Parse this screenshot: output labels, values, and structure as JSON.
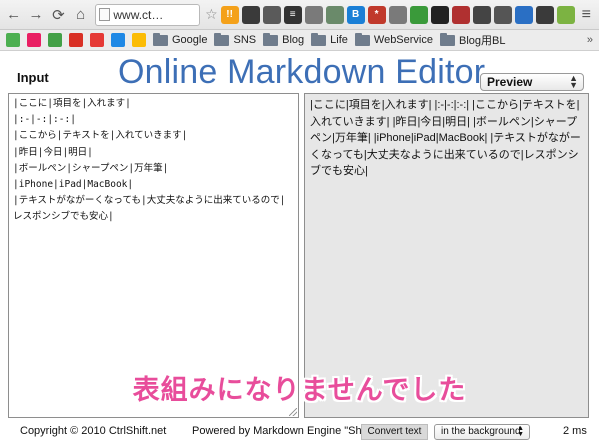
{
  "browser": {
    "url": "www.ct…",
    "extensions": [
      {
        "icon": "ext-hatebu-icon",
        "text": "!!",
        "color": "#f4a11a"
      },
      {
        "icon": "ext-evernote-icon",
        "text": "",
        "color": "#3a3a3a"
      },
      {
        "icon": "ext-gear-icon",
        "text": "",
        "color": "#5a5a5a"
      },
      {
        "icon": "ext-stack-icon",
        "text": "≡",
        "color": "#333333"
      },
      {
        "icon": "ext-pocket-icon",
        "text": "",
        "color": "#7a7a7a"
      },
      {
        "icon": "ext-elephant-icon",
        "text": "",
        "color": "#6a8a6a"
      },
      {
        "icon": "ext-b-icon",
        "text": "B",
        "color": "#1a7fd6"
      },
      {
        "icon": "ext-asterisk-icon",
        "text": "*",
        "color": "#c0392b"
      },
      {
        "icon": "ext-copy-icon",
        "text": "",
        "color": "#7a7a7a"
      },
      {
        "icon": "ext-leaf-icon",
        "text": "",
        "color": "#3a9a3a"
      },
      {
        "icon": "ext-circle-icon",
        "text": "",
        "color": "#222222"
      },
      {
        "icon": "ext-mask-icon",
        "text": "",
        "color": "#b03030"
      },
      {
        "icon": "ext-camera-icon",
        "text": "",
        "color": "#444444"
      },
      {
        "icon": "ext-pin-icon",
        "text": "",
        "color": "#555555"
      },
      {
        "icon": "ext-frame-icon",
        "text": "",
        "color": "#2a6fc4"
      },
      {
        "icon": "ext-chart-icon",
        "text": "",
        "color": "#3a3a3a"
      },
      {
        "icon": "ext-diamond-icon",
        "text": "",
        "color": "#7cb342"
      }
    ],
    "bookmarks": [
      {
        "type": "icon",
        "icon": "bookmark-green-icon",
        "color": "#4caf50"
      },
      {
        "type": "icon",
        "icon": "bookmark-flickr-icon",
        "color": "#e91e63"
      },
      {
        "type": "icon",
        "icon": "bookmark-leaf-icon",
        "color": "#43a047"
      },
      {
        "type": "icon",
        "icon": "bookmark-gmail-icon",
        "color": "#d93025"
      },
      {
        "type": "icon",
        "icon": "bookmark-red-icon",
        "color": "#e53935"
      },
      {
        "type": "icon",
        "icon": "bookmark-calendar-icon",
        "color": "#1e88e5"
      },
      {
        "type": "icon",
        "icon": "bookmark-drive-icon",
        "color": "#fbbc05"
      },
      {
        "type": "folder",
        "label": "Google"
      },
      {
        "type": "folder",
        "label": "SNS"
      },
      {
        "type": "folder",
        "label": "Blog"
      },
      {
        "type": "folder",
        "label": "Life"
      },
      {
        "type": "folder",
        "label": "WebService"
      },
      {
        "type": "folder",
        "label": "Blog用BL"
      }
    ],
    "more": "»"
  },
  "page": {
    "input_label": "Input",
    "title": "Online Markdown Editor",
    "preview_select": "Preview",
    "input_lines": [
      "|ここに|項目を|入れます|",
      "|:-|-:|:-:|",
      "|ここから|テキストを|入れていきます|",
      "|昨日|今日|明日|",
      "|ボールペン|シャープペン|万年筆|",
      "|iPhone|iPad|MacBook|",
      "|テキストがながーくなっても|大丈夫なように出来ているので|レスポンシブでも安心|"
    ],
    "preview_text": "|ここに|項目を|入れます| |:-|-:|:-:| |ここから|テキストを|入れていきます| |昨日|今日|明日| |ボールペン|シャープペン|万年筆| |iPhone|iPad|MacBook| |テキストがながーくなっても|大丈夫なように出来ているので|レスポンシブでも安心|",
    "caption": "表組みになりませんでした",
    "footer": {
      "copyright": "Copyright © 2010 CtrlShift.net",
      "powered": "Powered by Markdown Engine \"Sh",
      "convert_button": "Convert text",
      "mode_select": "in the background",
      "timing": "2 ms"
    }
  }
}
